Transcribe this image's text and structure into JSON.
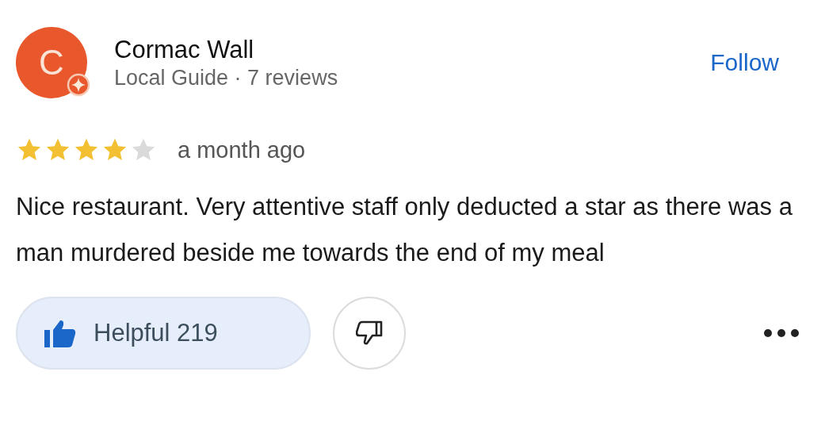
{
  "reviewer": {
    "initial": "C",
    "name": "Cormac Wall",
    "subtitle": "Local Guide · 7 reviews",
    "local_guide": true
  },
  "follow_label": "Follow",
  "review": {
    "stars": 4,
    "time": "a month ago",
    "text": "Nice restaurant. Very attentive staff only deducted a star as there was a man murdered beside me towards the end of my meal"
  },
  "actions": {
    "helpful": {
      "label": "Helpful 219",
      "selected": true
    },
    "not_helpful": {
      "selected": false
    }
  }
}
